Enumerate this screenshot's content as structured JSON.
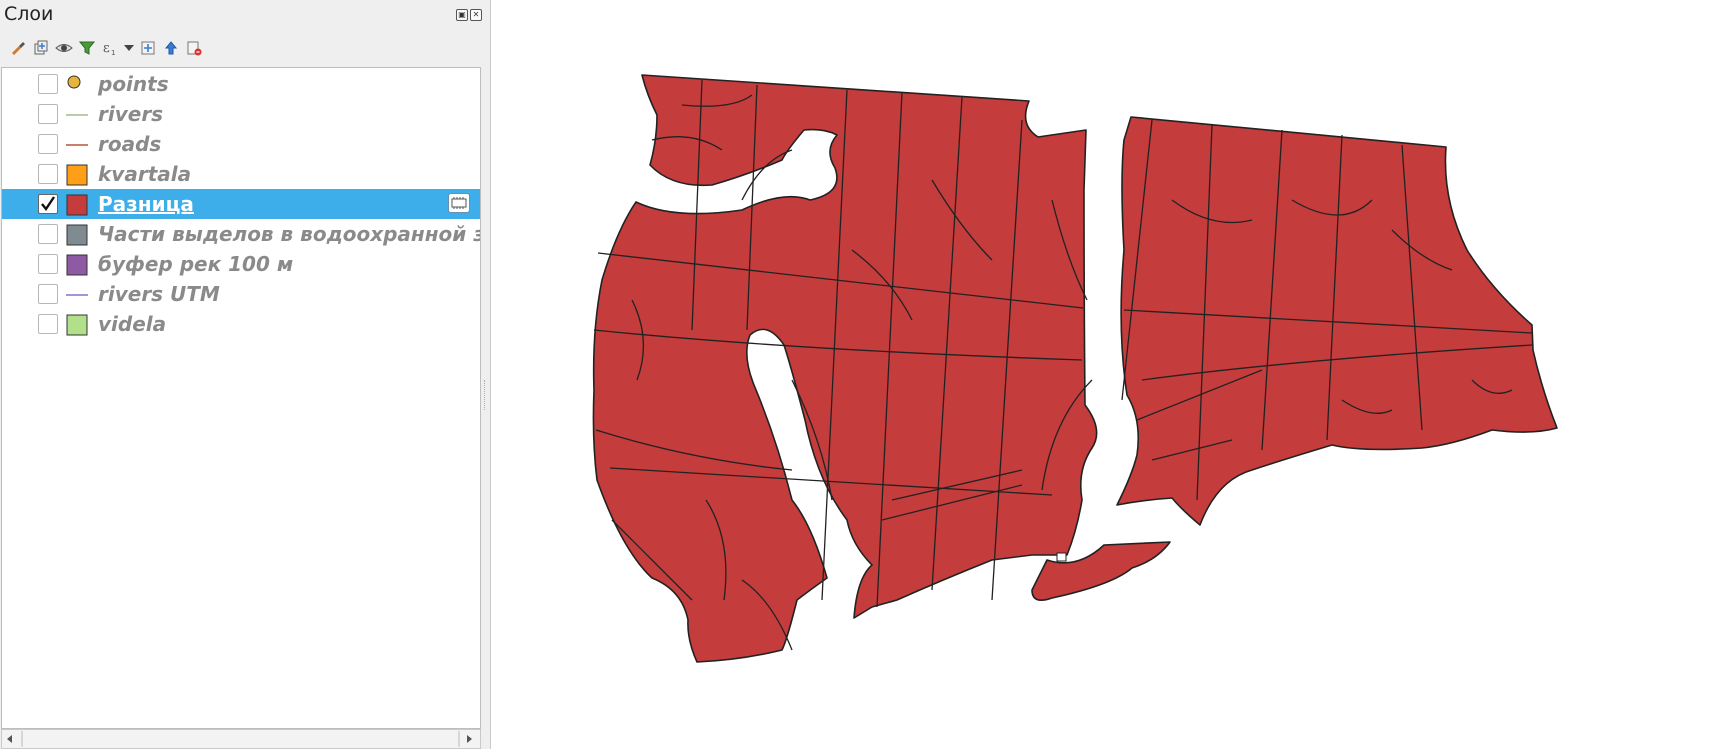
{
  "panel": {
    "title": "Слои",
    "float_button_icon": "float-icon",
    "close_button_icon": "close-icon"
  },
  "toolbar": {
    "items": [
      {
        "icon": "style-brush-icon"
      },
      {
        "icon": "add-group-icon"
      },
      {
        "icon": "visibility-eye-icon"
      },
      {
        "icon": "filter-icon"
      },
      {
        "icon": "expression-filter-icon"
      },
      {
        "icon": "dropdown-arrow-icon"
      },
      {
        "icon": "expand-all-icon"
      },
      {
        "icon": "collapse-all-icon"
      },
      {
        "icon": "remove-layer-icon"
      }
    ]
  },
  "layers": [
    {
      "name": "points",
      "checked": false,
      "symbol": "point",
      "color": "#e8b53a",
      "selected": false
    },
    {
      "name": "rivers",
      "checked": false,
      "symbol": "line",
      "color": "#a7b88f",
      "selected": false
    },
    {
      "name": "roads",
      "checked": false,
      "symbol": "line",
      "color": "#b8553a",
      "selected": false
    },
    {
      "name": "kvartala",
      "checked": false,
      "symbol": "fill",
      "color": "#ff9e17",
      "selected": false
    },
    {
      "name": "Разница",
      "checked": true,
      "symbol": "fill",
      "color": "#c43c3c",
      "selected": true
    },
    {
      "name": "Части выделов в водоохранной зоне —",
      "checked": false,
      "symbol": "fill",
      "color": "#7f8b91",
      "selected": false
    },
    {
      "name": "буфер рек 100 м",
      "checked": false,
      "symbol": "fill",
      "color": "#8e5aa3",
      "selected": false
    },
    {
      "name": "rivers UTM",
      "checked": false,
      "symbol": "line",
      "color": "#8a6fd0",
      "selected": false
    },
    {
      "name": "videla",
      "checked": false,
      "symbol": "fill",
      "color": "#b2df8a",
      "selected": false
    }
  ],
  "map": {
    "fill_color": "#c43c3c",
    "stroke_color": "#222222",
    "background": "#ffffff"
  }
}
